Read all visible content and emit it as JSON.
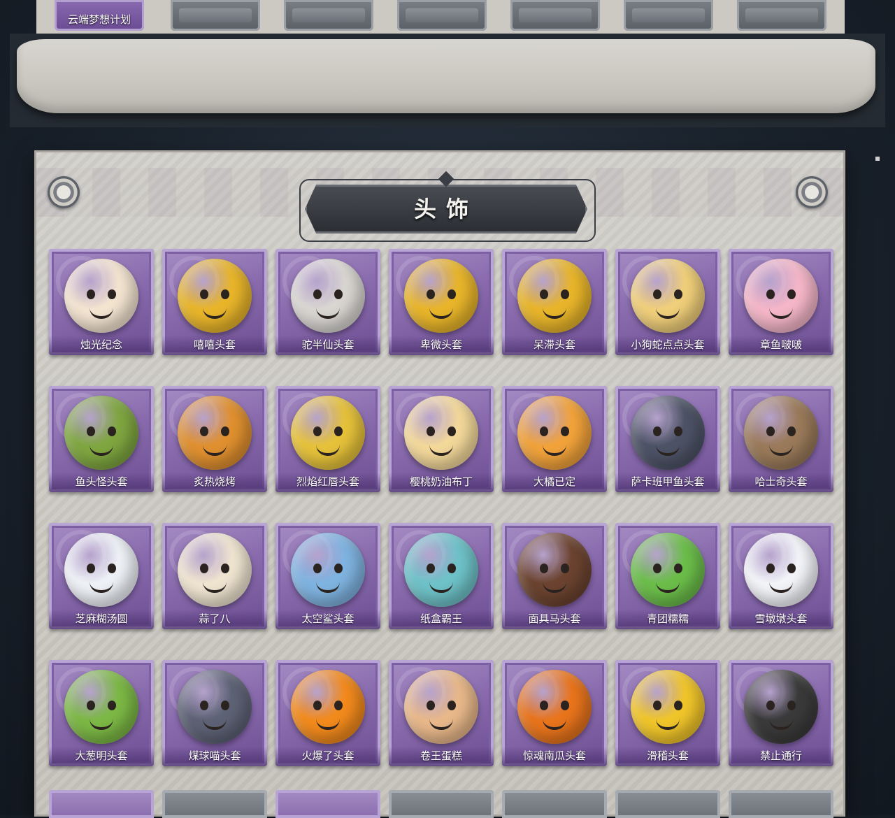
{
  "top_section": {
    "first_slot_label": "云端梦想计划"
  },
  "section": {
    "title": "头饰"
  },
  "colors": {
    "card_purple": "#8a6cae",
    "panel_stone": "#ccc9c2",
    "background": "#1a222c"
  },
  "items": [
    {
      "label": "烛光纪念",
      "icon": "candle-head-icon",
      "color": "#f3e4d0"
    },
    {
      "label": "嘻嘻头套",
      "icon": "grin-emoji-head-icon",
      "color": "#e8b52a"
    },
    {
      "label": "驼半仙头套",
      "icon": "sunglasses-alpaca-head-icon",
      "color": "#d9d6d2"
    },
    {
      "label": "卑微头套",
      "icon": "shy-emoji-head-icon",
      "color": "#e8b52a"
    },
    {
      "label": "呆滞头套",
      "icon": "dazed-emoji-head-icon",
      "color": "#e8b52a"
    },
    {
      "label": "小狗蛇点点头套",
      "icon": "snake-head-icon",
      "color": "#f0cf7a"
    },
    {
      "label": "章鱼啵啵",
      "icon": "pink-octopus-head-icon",
      "color": "#f4b6c8"
    },
    {
      "label": "鱼头怪头套",
      "icon": "fish-monster-head-icon",
      "color": "#7fa640"
    },
    {
      "label": "炙热烧烤",
      "icon": "bbq-meat-head-icon",
      "color": "#e0902f"
    },
    {
      "label": "烈焰红唇头套",
      "icon": "yellow-mouse-head-icon",
      "color": "#e6c23a"
    },
    {
      "label": "樱桃奶油布丁",
      "icon": "pudding-head-icon",
      "color": "#f3d89a"
    },
    {
      "label": "大橘已定",
      "icon": "orange-slice-head-icon",
      "color": "#f1a23a"
    },
    {
      "label": "萨卡班甲鱼头套",
      "icon": "sacabambaspis-head-icon",
      "color": "#4d5366"
    },
    {
      "label": "哈士奇头套",
      "icon": "husky-head-icon",
      "color": "#9a7a5a"
    },
    {
      "label": "芝麻糊汤圆",
      "icon": "dumpling-head-icon",
      "color": "#eef1f6"
    },
    {
      "label": "蒜了八",
      "icon": "garlic-head-icon",
      "color": "#efe4d0"
    },
    {
      "label": "太空鲨头套",
      "icon": "shark-head-icon",
      "color": "#7fb3e0"
    },
    {
      "label": "纸盒霸王",
      "icon": "cardboard-dino-head-icon",
      "color": "#6ec2c8"
    },
    {
      "label": "面具马头套",
      "icon": "horse-mask-head-icon",
      "color": "#6b4330"
    },
    {
      "label": "青团糯糯",
      "icon": "green-rice-ball-head-icon",
      "color": "#6bbd4a"
    },
    {
      "label": "雪墩墩头套",
      "icon": "snowman-head-icon",
      "color": "#f2f4f8"
    },
    {
      "label": "大葱明头套",
      "icon": "scallion-head-icon",
      "color": "#7cb845"
    },
    {
      "label": "煤球喵头套",
      "icon": "gray-cat-head-icon",
      "color": "#5d6275"
    },
    {
      "label": "火爆了头套",
      "icon": "fire-spirit-head-icon",
      "color": "#f28a1c"
    },
    {
      "label": "卷王蛋糕",
      "icon": "roll-cake-head-icon",
      "color": "#e8b88a"
    },
    {
      "label": "惊魂南瓜头套",
      "icon": "pumpkin-head-icon",
      "color": "#e8741c"
    },
    {
      "label": "滑稽头套",
      "icon": "smirk-emoji-head-icon",
      "color": "#f0c52a"
    },
    {
      "label": "禁止通行",
      "icon": "traffic-cone-head-icon",
      "color": "#3a3a3a"
    }
  ]
}
